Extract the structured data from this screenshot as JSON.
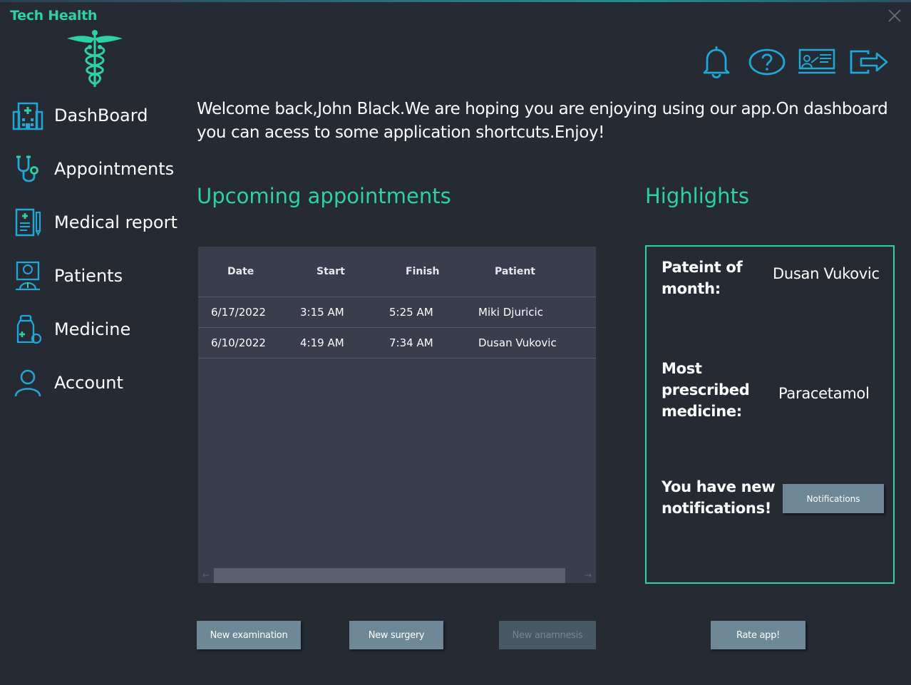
{
  "app": {
    "title": "Tech Health"
  },
  "sidebar": {
    "items": [
      {
        "label": "DashBoard",
        "icon": "hospital-icon"
      },
      {
        "label": "Appointments",
        "icon": "stethoscope-icon"
      },
      {
        "label": "Medical report",
        "icon": "medical-report-icon"
      },
      {
        "label": "Patients",
        "icon": "patient-icon"
      },
      {
        "label": "Medicine",
        "icon": "medicine-bottle-icon"
      },
      {
        "label": "Account",
        "icon": "user-icon"
      }
    ]
  },
  "toolbar": {
    "icons": [
      "bell-icon",
      "help-icon",
      "presentation-icon",
      "logout-icon"
    ]
  },
  "main": {
    "welcome": "Welcome back,John Black.We are hoping you are enjoying using our app.On dashboard you can acess to some application shortcuts.Enjoy!",
    "appointments_title": "Upcoming appointments",
    "highlights_title": "Highlights"
  },
  "appointments": {
    "columns": [
      "Date",
      "Start",
      "Finish",
      "Patient"
    ],
    "rows": [
      [
        "6/17/2022",
        "3:15 AM",
        "5:25 AM",
        "Miki Djuricic"
      ],
      [
        "6/10/2022",
        "4:19 AM",
        "7:34 AM",
        "Dusan Vukovic"
      ]
    ]
  },
  "highlights": {
    "patient_label": "Pateint of month:",
    "patient_value": "Dusan Vukovic",
    "medicine_label": "Most prescribed medicine:",
    "medicine_value": "Paracetamol",
    "notif_label": "You have new notifications!",
    "notif_button": "Notifications"
  },
  "actions": {
    "new_examination": "New examination",
    "new_surgery": "New surgery",
    "new_anamnesis": "New anamnesis",
    "rate_app": "Rate app!"
  },
  "colors": {
    "background": "#252a33",
    "accent": "#2dd1a4",
    "icon_blue": "#1fa7d6",
    "panel": "#393d4c",
    "button": "#6e8897"
  }
}
